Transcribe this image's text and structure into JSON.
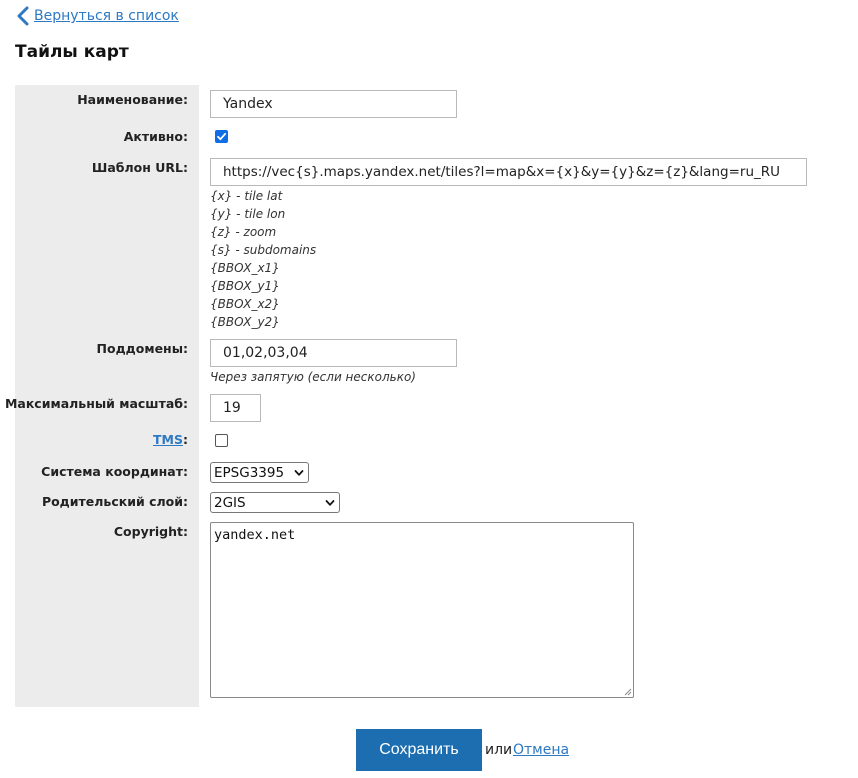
{
  "nav": {
    "back_label": "Вернуться в список"
  },
  "page": {
    "title": "Тайлы карт"
  },
  "colors": {
    "link": "#2d79c3",
    "primary_button": "#1c6eb0",
    "label_column_bg": "#ececec",
    "checkbox_on": "#0f6ee5"
  },
  "form": {
    "name": {
      "label": "Наименование:",
      "value": "Yandex"
    },
    "active": {
      "label": "Активно:",
      "checked": true
    },
    "url_template": {
      "label": "Шаблон URL:",
      "value": "https://vec{s}.maps.yandex.net/tiles?l=map&x={x}&y={y}&z={z}&lang=ru_RU",
      "hints": [
        "{x} - tile lat",
        "{y} - tile lon",
        "{z} - zoom",
        "{s} - subdomains",
        "{BBOX_x1}",
        "{BBOX_y1}",
        "{BBOX_x2}",
        "{BBOX_y2}"
      ]
    },
    "subdomains": {
      "label": "Поддомены:",
      "value": "01,02,03,04",
      "hint": "Через запятую (если несколько)"
    },
    "max_zoom": {
      "label": "Максимальный масштаб:",
      "value": "19"
    },
    "tms": {
      "label": "TMS",
      "suffix": ":",
      "checked": false
    },
    "coord_system": {
      "label": "Система координат:",
      "selected": "EPSG3395"
    },
    "parent_layer": {
      "label": "Родительский слой:",
      "selected": "2GIS"
    },
    "copyright": {
      "label": "Copyright:",
      "value": "yandex.net"
    }
  },
  "actions": {
    "save_label": "Сохранить",
    "or_text": "или",
    "cancel_label": "Отмена"
  },
  "icons": {
    "back": "chevron-left-icon",
    "check": "check-icon",
    "dropdown": "chevron-down-icon",
    "resize": "resize-grip-icon"
  }
}
